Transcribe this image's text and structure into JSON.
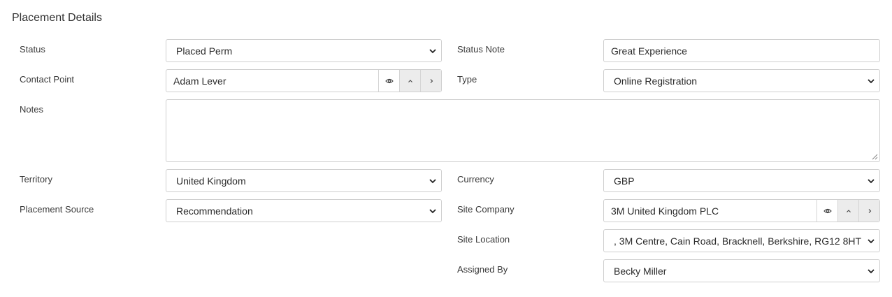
{
  "section": {
    "title": "Placement Details"
  },
  "fields": {
    "status": {
      "label": "Status",
      "value": "Placed Perm"
    },
    "status_note": {
      "label": "Status Note",
      "value": "Great Experience"
    },
    "contact_point": {
      "label": "Contact Point",
      "value": "Adam Lever"
    },
    "type": {
      "label": "Type",
      "value": "Online Registration"
    },
    "notes": {
      "label": "Notes",
      "value": ""
    },
    "territory": {
      "label": "Territory",
      "value": "United Kingdom"
    },
    "currency": {
      "label": "Currency",
      "value": "GBP"
    },
    "placement_source": {
      "label": "Placement Source",
      "value": "Recommendation"
    },
    "site_company": {
      "label": "Site Company",
      "value": "3M United Kingdom PLC"
    },
    "site_location": {
      "label": "Site Location",
      "value": ", 3M Centre, Cain Road, Bracknell, Berkshire, RG12 8HT"
    },
    "assigned_by": {
      "label": "Assigned By",
      "value": "Becky Miller"
    }
  },
  "icons": {
    "view": "eye-icon",
    "previous": "chevron-up-icon",
    "next": "chevron-right-icon",
    "dropdown": "chevron-down-icon"
  }
}
